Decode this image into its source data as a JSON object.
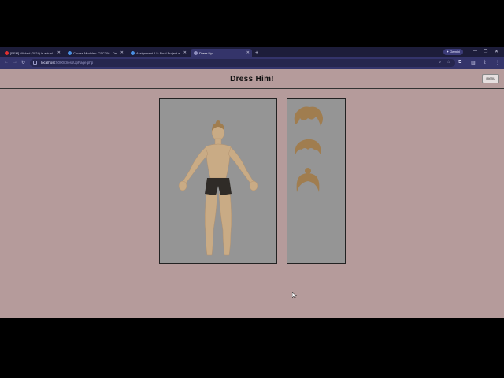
{
  "browser": {
    "tabs": [
      {
        "label": "[REM] Wicked (2024) is actual...",
        "favicon_color": "#e03030",
        "active": false
      },
      {
        "label": "Course Modules: CSC206 - Dev...",
        "favicon_color": "#4a90e2",
        "active": false
      },
      {
        "label": "Assignment 6.5: Final Project w...",
        "favicon_color": "#4a90e2",
        "active": false
      },
      {
        "label": "Dress Up!",
        "favicon_color": "#8f8fbf",
        "active": true
      }
    ],
    "new_tab_symbol": "+",
    "gemini_label": "✦ Gemini",
    "url_host": "localhost",
    "url_path": ":5000/dressUpPage.php",
    "window_controls": [
      "—",
      "❐",
      "✕"
    ]
  },
  "page": {
    "title": "Dress Him!",
    "menu_label": "menu"
  },
  "hair_options": [
    {
      "name": "messy-hair",
      "color": "#a07d4f"
    },
    {
      "name": "spiky-hair",
      "color": "#a07d4f"
    },
    {
      "name": "bun-hair",
      "color": "#a07d4f"
    }
  ],
  "colors": {
    "page_bg": "#b59b9b",
    "panel_bg": "#959595",
    "skin": "#c9ab85",
    "shorts": "#2f2b27",
    "hair": "#a07d4f"
  }
}
